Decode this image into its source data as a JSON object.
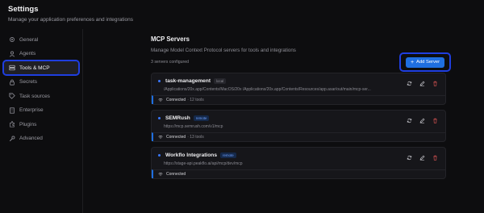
{
  "header": {
    "title": "Settings",
    "subtitle": "Manage your application preferences and integrations"
  },
  "sidebar": {
    "items": [
      {
        "label": "General",
        "icon": "gear-icon"
      },
      {
        "label": "Agents",
        "icon": "user-icon"
      },
      {
        "label": "Tools & MCP",
        "icon": "server-icon",
        "active": true
      },
      {
        "label": "Secrets",
        "icon": "lock-icon"
      },
      {
        "label": "Task sources",
        "icon": "tag-icon"
      },
      {
        "label": "Enterprise",
        "icon": "building-icon"
      },
      {
        "label": "Plugins",
        "icon": "plugin-icon"
      },
      {
        "label": "Advanced",
        "icon": "wrench-icon"
      }
    ]
  },
  "main": {
    "title": "MCP Servers",
    "description": "Manage Model Context Protocol servers for tools and integrations",
    "count_text": "3 servers configured",
    "add_button_label": "Add Server",
    "servers": [
      {
        "name": "task-management",
        "badge": "local",
        "path": "/Applications/20x.app/Contents/MacOS/20x /Applications/20x.app/Contents/Resources/app.asar/out/main/mcp-ser...",
        "status": "Connected",
        "tools": "· 12 tools"
      },
      {
        "name": "SEMRush",
        "badge": "remote",
        "path": "https://mcp.semrush.com/v1/mcp",
        "status": "Connected",
        "tools": "· 13 tools"
      },
      {
        "name": "Workflo Integrations",
        "badge": "remote",
        "path": "https://stage-api.peakflo.ai/api/mcp/dev/mcp",
        "status": "Connected",
        "tools": ""
      }
    ]
  },
  "colors": {
    "accent": "#1f6fe0",
    "highlight_outline": "#1f3ee0",
    "background": "#0d0d0f"
  }
}
